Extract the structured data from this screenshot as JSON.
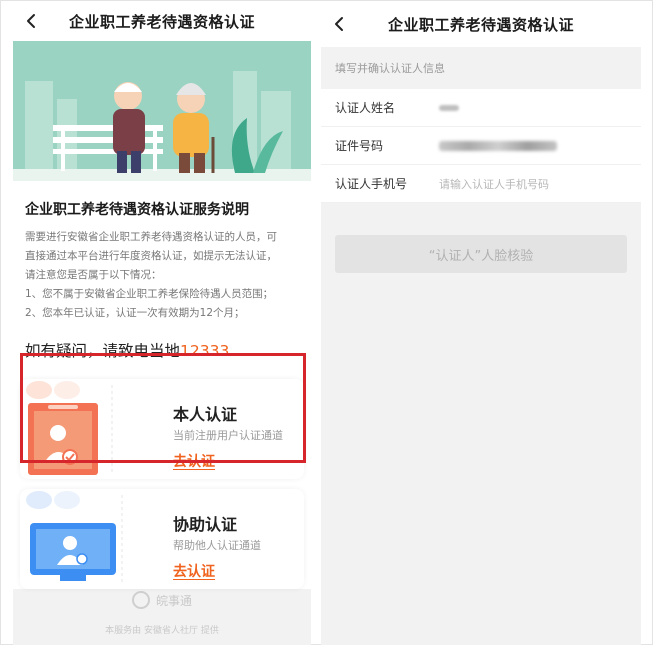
{
  "left": {
    "nav": {
      "title": "企业职工养老待遇资格认证"
    },
    "info": {
      "heading": "企业职工养老待遇资格认证服务说明",
      "lines": [
        "需要进行安徽省企业职工养老待遇资格认证的人员，可",
        "直接通过本平台进行年度资格认证，如提示无法认证，",
        "请注意您是否属于以下情况：",
        "1、您不属于安徽省企业职工养老保险待遇人员范围；",
        "2、您本年已认证，认证一次有效期为12个月；"
      ]
    },
    "contact": {
      "text": "如有疑问，请致电当地",
      "phone": "12333"
    },
    "cards": [
      {
        "title": "本人认证",
        "subtitle": "当前注册用户认证通道",
        "link": "去认证"
      },
      {
        "title": "协助认证",
        "subtitle": "帮助他人认证通道",
        "link": "去认证"
      }
    ],
    "footer": {
      "logo": "皖事通",
      "credit": "本服务由 安徽省人社厅 提供"
    }
  },
  "right": {
    "nav": {
      "title": "企业职工养老待遇资格认证"
    },
    "section_hint": "填写并确认认证人信息",
    "fields": [
      {
        "label": "认证人姓名"
      },
      {
        "label": "证件号码"
      },
      {
        "label": "认证人手机号",
        "placeholder": "请输入认证人手机号码"
      }
    ],
    "face_button": "“认证人”人脸核验"
  },
  "colors": {
    "accent": "#f0631f",
    "highlight": "#d6262b",
    "banner": "#9ad3c2"
  }
}
